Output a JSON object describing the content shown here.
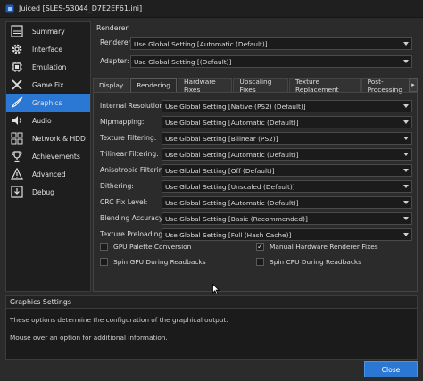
{
  "window": {
    "title": "Juiced [SLES-53044_D7E2EF61.ini]"
  },
  "sidebar": {
    "items": [
      {
        "label": "Summary",
        "icon": "list-icon"
      },
      {
        "label": "Interface",
        "icon": "gear-icon"
      },
      {
        "label": "Emulation",
        "icon": "emulation-chip-icon"
      },
      {
        "label": "Game Fix",
        "icon": "tools-icon"
      },
      {
        "label": "Graphics",
        "icon": "brush-icon",
        "active": true
      },
      {
        "label": "Audio",
        "icon": "speaker-icon"
      },
      {
        "label": "Network & HDD",
        "icon": "network-icon"
      },
      {
        "label": "Achievements",
        "icon": "trophy-icon"
      },
      {
        "label": "Advanced",
        "icon": "advanced-icon"
      },
      {
        "label": "Debug",
        "icon": "debug-icon"
      }
    ]
  },
  "renderer_section": {
    "heading": "Renderer",
    "renderer_label": "Renderer:",
    "renderer_value": "Use Global Setting [Automatic (Default)]",
    "adapter_label": "Adapter:",
    "adapter_value": "Use Global Setting [(Default)]"
  },
  "tabs": [
    {
      "label": "Display"
    },
    {
      "label": "Rendering",
      "active": true
    },
    {
      "label": "Hardware Fixes"
    },
    {
      "label": "Upscaling Fixes"
    },
    {
      "label": "Texture Replacement"
    },
    {
      "label": "Post-Processing"
    }
  ],
  "tab_scroll_glyph": "▸",
  "settings": [
    {
      "label": "Internal Resolution:",
      "value": "Use Global Setting [Native (PS2) (Default)]"
    },
    {
      "label": "Mipmapping:",
      "value": "Use Global Setting [Automatic (Default)]"
    },
    {
      "label": "Texture Filtering:",
      "value": "Use Global Setting [Bilinear (PS2)]"
    },
    {
      "label": "Trilinear Filtering:",
      "value": "Use Global Setting [Automatic (Default)]"
    },
    {
      "label": "Anisotropic Filtering:",
      "value": "Use Global Setting [Off (Default)]"
    },
    {
      "label": "Dithering:",
      "value": "Use Global Setting [Unscaled (Default)]"
    },
    {
      "label": "CRC Fix Level:",
      "value": "Use Global Setting [Automatic (Default)]"
    },
    {
      "label": "Blending Accuracy:",
      "value": "Use Global Setting [Basic (Recommended)]"
    },
    {
      "label": "Texture Preloading:",
      "value": "Use Global Setting [Full (Hash Cache)]"
    }
  ],
  "checkboxes": [
    {
      "label": "GPU Palette Conversion",
      "checked": false
    },
    {
      "label": "Manual Hardware Renderer Fixes",
      "checked": true
    },
    {
      "label": "Spin GPU During Readbacks",
      "checked": false
    },
    {
      "label": "Spin CPU During Readbacks",
      "checked": false
    }
  ],
  "check_glyph": "✓",
  "info": {
    "heading": "Graphics Settings",
    "line1": "These options determine the configuration of the graphical output.",
    "line2": "Mouse over an option for additional information."
  },
  "footer": {
    "close_label": "Close"
  },
  "colors": {
    "accent": "#2a78d4",
    "background": "#2b2b2b",
    "panel": "#1b1b1b"
  }
}
